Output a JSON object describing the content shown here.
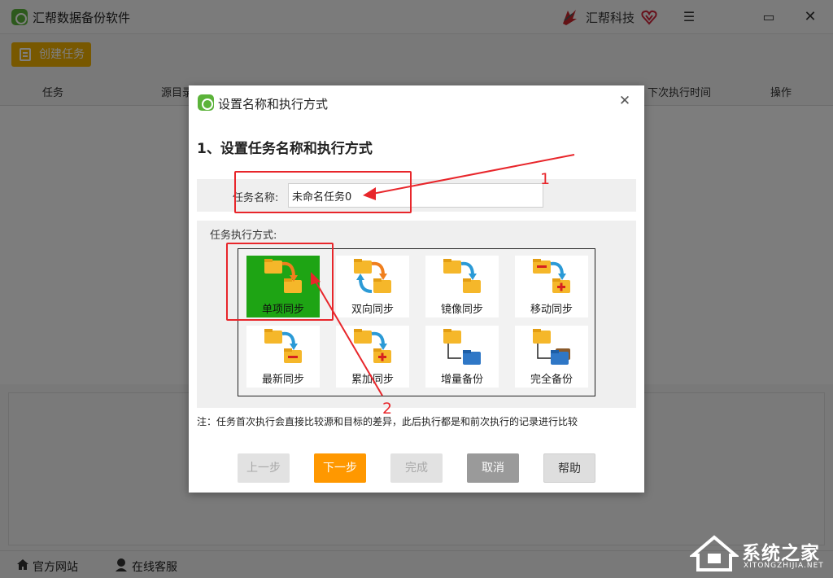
{
  "app": {
    "title": "汇帮数据备份软件",
    "brand_name": "汇帮科技",
    "create_task_label": "创建任务"
  },
  "table": {
    "columns": [
      "任务",
      "源目录",
      "下次执行时间",
      "操作"
    ]
  },
  "footer": {
    "website_label": "官方网站",
    "service_label": "在线客服"
  },
  "dialog": {
    "title": "设置名称和执行方式",
    "section_title": "1、设置任务名称和执行方式",
    "name_label": "任务名称:",
    "name_value": "未命名任务0",
    "mode_label": "任务执行方式:",
    "modes": [
      {
        "label": "单项同步",
        "selected": true
      },
      {
        "label": "双向同步",
        "selected": false
      },
      {
        "label": "镜像同步",
        "selected": false
      },
      {
        "label": "移动同步",
        "selected": false
      },
      {
        "label": "最新同步",
        "selected": false
      },
      {
        "label": "累加同步",
        "selected": false
      },
      {
        "label": "增量备份",
        "selected": false
      },
      {
        "label": "完全备份",
        "selected": false
      }
    ],
    "note": "注：任务首次执行会直接比较源和目标的差异，此后执行都是和前次执行的记录进行比较",
    "buttons": {
      "prev": "上一步",
      "next": "下一步",
      "finish": "完成",
      "cancel": "取消",
      "help": "帮助"
    }
  },
  "annotations": {
    "marker_1": "1",
    "marker_2": "2"
  },
  "watermark": {
    "text": "系统之家",
    "url": "XITONGZHIJIA.NET"
  },
  "colors": {
    "accent_orange": "#ff9800",
    "create_button": "#f0b000",
    "selected_mode": "#1ea414",
    "annotation_red": "#e8262b",
    "logo_green": "#5bb33a"
  }
}
